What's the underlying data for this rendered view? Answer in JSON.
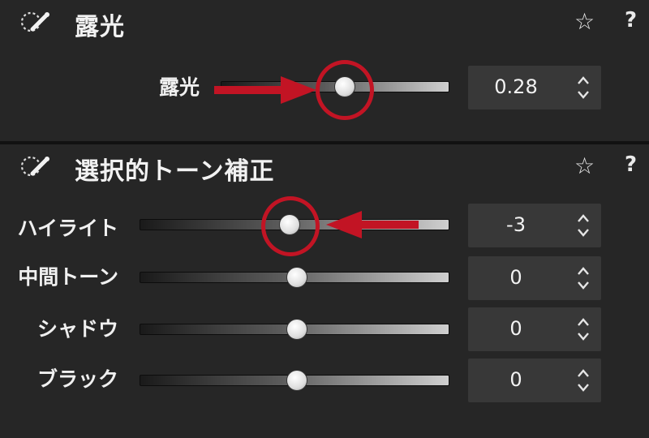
{
  "exposure_panel": {
    "title": "露光",
    "star": "☆",
    "help": "?",
    "icon": "auto-adjust-wand-icon",
    "slider": {
      "label": "露光",
      "value": "0.28",
      "fraction": 0.55
    }
  },
  "tone_panel": {
    "title": "選択的トーン補正",
    "star": "☆",
    "help": "?",
    "icon": "auto-adjust-wand-icon",
    "sliders": [
      {
        "label": "ハイライト",
        "value": "-3",
        "fraction": 0.48
      },
      {
        "label": "中間トーン",
        "value": "0",
        "fraction": 0.5
      },
      {
        "label": "シャドウ",
        "value": "0",
        "fraction": 0.5
      },
      {
        "label": "ブラック",
        "value": "0",
        "fraction": 0.5
      }
    ]
  },
  "annotations": {
    "color": "#c21424"
  }
}
